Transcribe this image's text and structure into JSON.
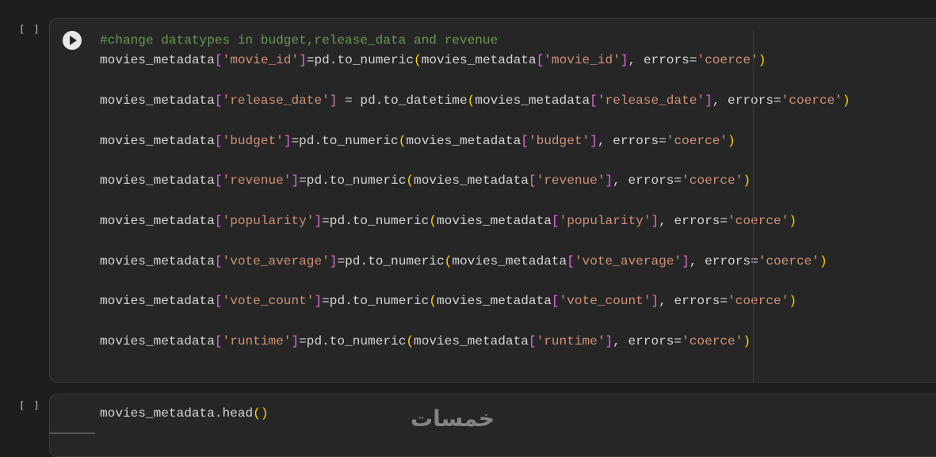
{
  "cells": [
    {
      "bracket": "[ ]",
      "lines": [
        "#change datatypes in budget,release_data and revenue",
        "movies_metadata['movie_id']=pd.to_numeric(movies_metadata['movie_id'], errors='coerce')",
        "",
        "movies_metadata['release_date'] = pd.to_datetime(movies_metadata['release_date'], errors='coerce')",
        "",
        "movies_metadata['budget']=pd.to_numeric(movies_metadata['budget'], errors='coerce')",
        "",
        "movies_metadata['revenue']=pd.to_numeric(movies_metadata['revenue'], errors='coerce')",
        "",
        "movies_metadata['popularity']=pd.to_numeric(movies_metadata['popularity'], errors='coerce')",
        "",
        "movies_metadata['vote_average']=pd.to_numeric(movies_metadata['vote_average'], errors='coerce')",
        "",
        "movies_metadata['vote_count']=pd.to_numeric(movies_metadata['vote_count'], errors='coerce')",
        "",
        "movies_metadata['runtime']=pd.to_numeric(movies_metadata['runtime'], errors='coerce')"
      ]
    },
    {
      "bracket": "[ ]",
      "lines": [
        "movies_metadata.head()"
      ]
    }
  ],
  "run_button_icon": "play-icon",
  "watermark": "خمسات",
  "colors": {
    "background": "#1e1e1e",
    "cell_background": "#262626",
    "comment": "#6a9955",
    "string": "#ce9178",
    "bracket_paren": "#ffd700",
    "bracket_square": "#da70d6",
    "text": "#d4d4d4"
  }
}
